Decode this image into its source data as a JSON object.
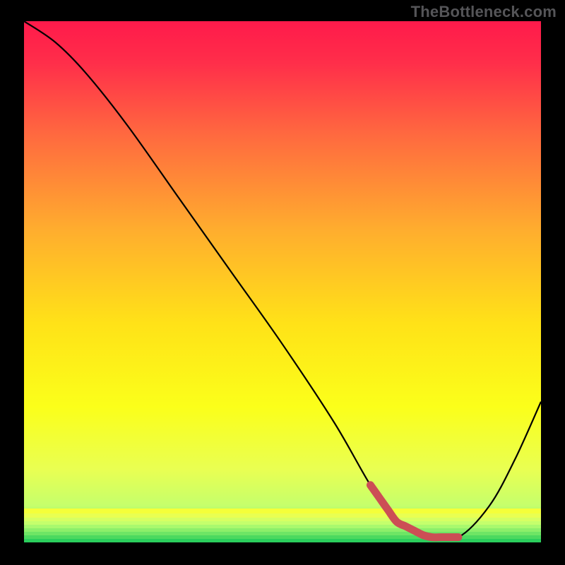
{
  "watermark": "TheBottleneck.com",
  "chart_data": {
    "type": "line",
    "title": "",
    "xlabel": "",
    "ylabel": "",
    "xlim": [
      0,
      100
    ],
    "ylim": [
      0,
      100
    ],
    "grid": false,
    "series": [
      {
        "name": "bottleneck-curve",
        "x": [
          0,
          6,
          12,
          20,
          30,
          40,
          50,
          60,
          67,
          72,
          78,
          84,
          90,
          95,
          100
        ],
        "values": [
          100,
          96,
          90,
          80,
          66,
          52,
          38,
          23,
          11,
          4,
          1,
          1,
          7,
          16,
          27
        ]
      }
    ],
    "accent_range_x": [
      67,
      84
    ],
    "gradient_stops": [
      {
        "pos": 0.0,
        "color": "#ff1a4b"
      },
      {
        "pos": 0.08,
        "color": "#ff2e4a"
      },
      {
        "pos": 0.22,
        "color": "#ff6a3f"
      },
      {
        "pos": 0.4,
        "color": "#ffad2e"
      },
      {
        "pos": 0.58,
        "color": "#ffe218"
      },
      {
        "pos": 0.74,
        "color": "#fbff1a"
      },
      {
        "pos": 0.86,
        "color": "#e9ff52"
      },
      {
        "pos": 0.93,
        "color": "#c5ff6c"
      },
      {
        "pos": 1.0,
        "color": "#2bce5c"
      }
    ],
    "bottom_stripes": [
      {
        "h": 7,
        "color": "#f4ff3a"
      },
      {
        "h": 6,
        "color": "#e9ff52"
      },
      {
        "h": 5,
        "color": "#d7ff62"
      },
      {
        "h": 5,
        "color": "#c5ff6c"
      },
      {
        "h": 5,
        "color": "#a9f96e"
      },
      {
        "h": 5,
        "color": "#8cef6a"
      },
      {
        "h": 5,
        "color": "#6ee565"
      },
      {
        "h": 5,
        "color": "#4cd95f"
      },
      {
        "h": 5,
        "color": "#2bce5c"
      }
    ],
    "accent": {
      "color": "#cc4e55",
      "stroke_width": 11
    },
    "curve_style": {
      "color": "#000000",
      "stroke_width": 2.2
    }
  }
}
